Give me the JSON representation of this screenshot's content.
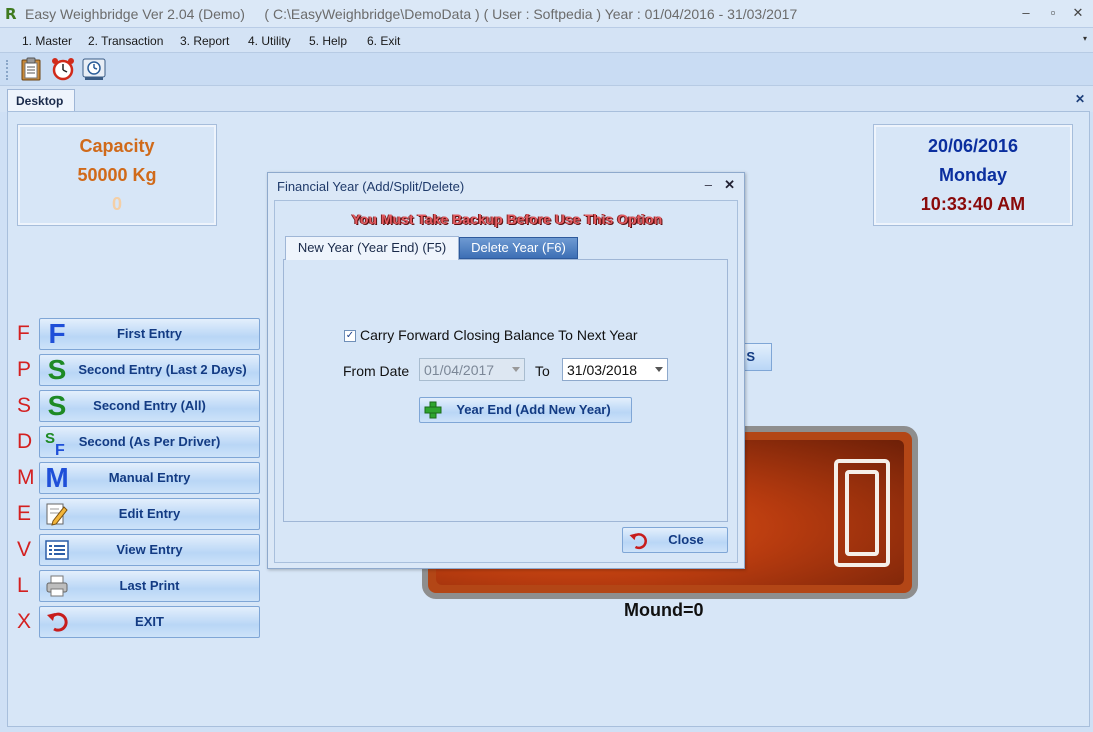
{
  "window": {
    "title": "Easy Weighbridge Ver 2.04 (Demo)     ( C:\\EasyWeighbridge\\DemoData ) ( User : Softpedia ) Year : 01/04/2016 - 31/03/2017",
    "app_icon": "R",
    "minimize": "–",
    "maximize": "▫",
    "close": "✕"
  },
  "menu": {
    "items": [
      "1. Master",
      "2. Transaction",
      "3. Report",
      "4. Utility",
      "5. Help",
      "6. Exit"
    ],
    "overflow": "▾"
  },
  "toolbar": {
    "icons": [
      "clipboard-icon",
      "alarm-clock-icon",
      "backup-icon"
    ]
  },
  "tabs": {
    "desktop": "Desktop",
    "close": "✕"
  },
  "capacity": {
    "title": "Capacity",
    "value": "50000 Kg",
    "current": "0"
  },
  "datetime": {
    "date": "20/06/2016",
    "day": "Monday",
    "time": "10:33:40 AM"
  },
  "side_buttons": [
    {
      "key": "F",
      "label": "First Entry",
      "icon": "F"
    },
    {
      "key": "P",
      "label": "Second Entry (Last 2 Days)",
      "icon": "S"
    },
    {
      "key": "S",
      "label": "Second Entry (All)",
      "icon": "S"
    },
    {
      "key": "D",
      "label": "Second (As Per Driver)",
      "icon": "SF"
    },
    {
      "key": "M",
      "label": "Manual Entry",
      "icon": "M"
    },
    {
      "key": "E",
      "label": "Edit Entry",
      "icon": "edit-icon"
    },
    {
      "key": "V",
      "label": "View Entry",
      "icon": "list-icon"
    },
    {
      "key": "L",
      "label": "Last Print",
      "icon": "printer-icon"
    },
    {
      "key": "X",
      "label": "EXIT",
      "icon": "undo-icon"
    }
  ],
  "partial_button": {
    "label": "S"
  },
  "scale": {
    "reading": "0",
    "mound_label": "Mound=0"
  },
  "dialog": {
    "title": "Financial Year (Add/Split/Delete)",
    "minimize": "–",
    "close": "✕",
    "warning": "You Must Take Backup Before Use This Option",
    "tabs": [
      "New Year (Year End) (F5)",
      "Delete Year (F6)"
    ],
    "carry_forward_label": "Carry Forward Closing Balance To Next Year",
    "carry_forward_checked": true,
    "from_label": "From Date",
    "from_value": "01/04/2017",
    "to_label": "To",
    "to_value": "31/03/2018",
    "year_end_button": "Year End (Add New Year)",
    "close_button": "Close"
  },
  "colors": {
    "capacity": "#d06a1a",
    "date": "#0b2f9f",
    "time": "#8a0a0a",
    "side_letter": "#d42020",
    "button_text": "#133b83",
    "display": "#b73b0f"
  }
}
